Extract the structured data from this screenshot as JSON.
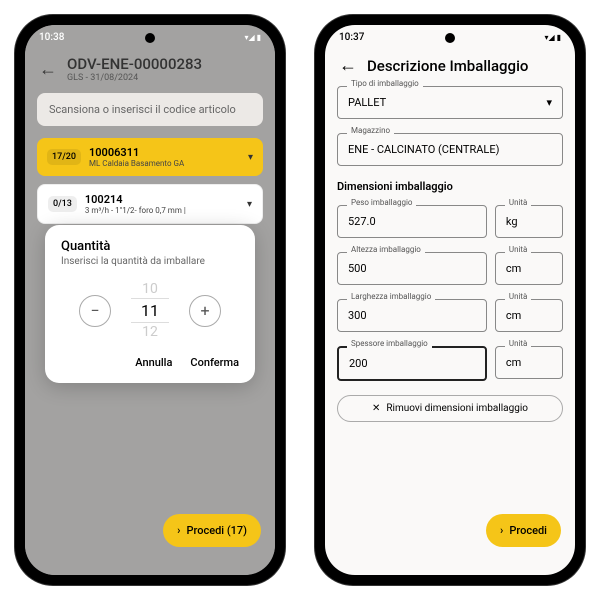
{
  "left": {
    "status": {
      "time": "10:38",
      "icons": "▾◢ ▮"
    },
    "header": {
      "title": "ODV-ENE-00000283",
      "subtitle": "GLS - 31/08/2024"
    },
    "scan_placeholder": "Scansiona o inserisci il codice articolo",
    "items": [
      {
        "badge": "17/20",
        "code": "10006311",
        "desc": "ML               Caldaia Basamento GA"
      },
      {
        "badge": "0/13",
        "code": "100214",
        "desc": "3 m³/h - 1\"1/2- foro 0,7 mm                  |"
      }
    ],
    "dialog": {
      "title": "Quantità",
      "sub": "Inserisci la quantità da imballare",
      "prev": "10",
      "value": "11",
      "next": "12",
      "cancel": "Annulla",
      "confirm": "Conferma"
    },
    "fab": "Procedi (17)"
  },
  "right": {
    "status": {
      "time": "10:37",
      "icons": "▾◢ ▮"
    },
    "title": "Descrizione Imballaggio",
    "type": {
      "label": "Tipo di imballaggio",
      "value": "PALLET"
    },
    "warehouse": {
      "label": "Magazzino",
      "value": "ENE - CALCINATO (CENTRALE)"
    },
    "dims_title": "Dimensioni imballaggio",
    "fields": {
      "weight": {
        "label": "Peso imballaggio",
        "value": "527.0",
        "unit_label": "Unità",
        "unit": "kg"
      },
      "height": {
        "label": "Altezza imballaggio",
        "value": "500",
        "unit_label": "Unità",
        "unit": "cm"
      },
      "width": {
        "label": "Larghezza imballaggio",
        "value": "300",
        "unit_label": "Unità",
        "unit": "cm"
      },
      "depth": {
        "label": "Spessore imballaggio",
        "value": "200",
        "unit_label": "Unità",
        "unit": "cm"
      }
    },
    "remove": "Rimuovi dimensioni imballaggio",
    "fab": "Procedi"
  }
}
